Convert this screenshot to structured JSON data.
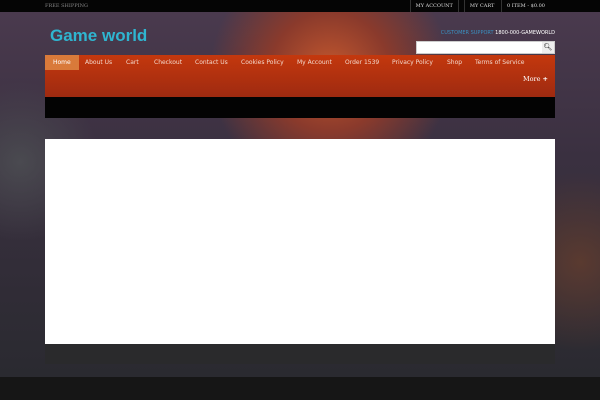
{
  "topbar": {
    "free_shipping": "FREE SHIPPING",
    "my_account": "MY ACCOUNT",
    "my_cart": "MY CART",
    "cart_summary": "0 ITEM - $0.00"
  },
  "header": {
    "logo": "Game world",
    "support_label": "CUSTOMER SUPPORT",
    "support_phone": "1800-000-GAMEWORLD",
    "search_placeholder": ""
  },
  "nav": {
    "items": [
      "Home",
      "About Us",
      "Cart",
      "Checkout",
      "Contact Us",
      "Cookies Policy",
      "My Account",
      "Order 1539",
      "Privacy Policy",
      "Shop",
      "Terms of Service"
    ],
    "more": "More"
  }
}
